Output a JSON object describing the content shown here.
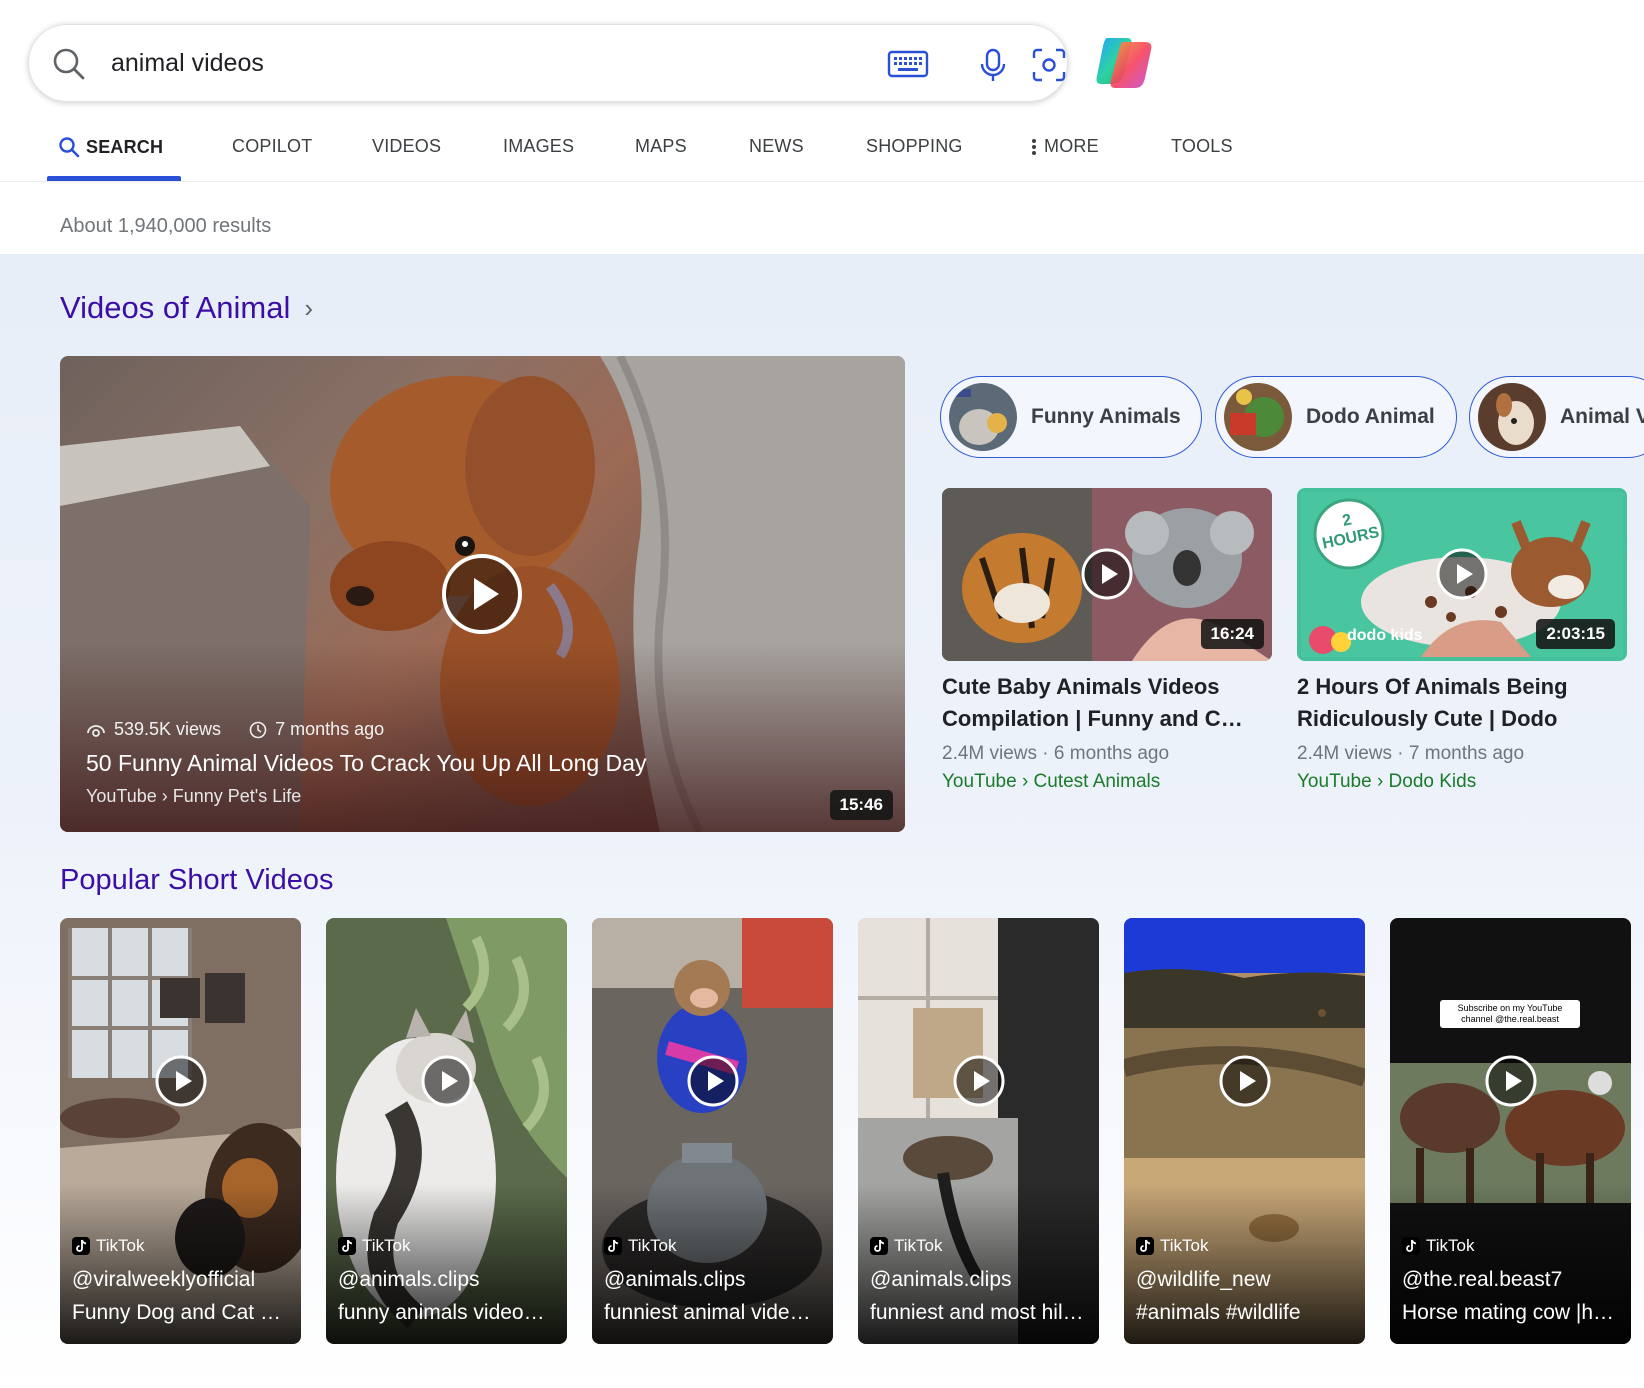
{
  "search": {
    "query": "animal videos"
  },
  "tabs": [
    {
      "label": "SEARCH"
    },
    {
      "label": "COPILOT"
    },
    {
      "label": "VIDEOS"
    },
    {
      "label": "IMAGES"
    },
    {
      "label": "MAPS"
    },
    {
      "label": "NEWS"
    },
    {
      "label": "SHOPPING"
    },
    {
      "label": "MORE"
    },
    {
      "label": "TOOLS"
    }
  ],
  "results_count": "About 1,940,000 results",
  "videos_section": {
    "title": "Videos of Animal",
    "hero": {
      "views": "539.5K views",
      "age": "7 months ago",
      "title": "50 Funny Animal Videos To Crack You Up All Long Day",
      "source": "YouTube › Funny Pet's Life",
      "duration": "15:46"
    },
    "chips": [
      {
        "label": "Funny Animals"
      },
      {
        "label": "Dodo Animal"
      },
      {
        "label": "Animal V"
      }
    ],
    "cards": [
      {
        "title_line1": "Cute Baby Animals Videos",
        "title_line2": "Compilation | Funny and C…",
        "meta": "2.4M views · 6 months ago",
        "source": "YouTube › Cutest Animals",
        "duration": "16:24"
      },
      {
        "title_line1": "2 Hours Of Animals Being",
        "title_line2": "Ridiculously Cute | Dodo",
        "meta": "2.4M views · 7 months ago",
        "source": "YouTube › Dodo Kids",
        "duration": "2:03:15",
        "badge": "2 HOURS",
        "logo_text": "dodo kids"
      }
    ]
  },
  "shorts_section": {
    "title": "Popular Short Videos",
    "items": [
      {
        "app": "TikTok",
        "author": "@viralweeklyofficial",
        "title": "Funny Dog and Cat …"
      },
      {
        "app": "TikTok",
        "author": "@animals.clips",
        "title": "funny animals video…"
      },
      {
        "app": "TikTok",
        "author": "@animals.clips",
        "title": "funniest animal vide…"
      },
      {
        "app": "TikTok",
        "author": "@animals.clips",
        "title": "funniest and most hil…"
      },
      {
        "app": "TikTok",
        "author": "@wildlife_new",
        "title": "#animals #wildlife"
      },
      {
        "app": "TikTok",
        "author": "@the.real.beast7",
        "title": "Horse mating cow |h…",
        "overlay_text": "Subscribe on my YouTube channel @the.real.beast"
      }
    ]
  },
  "colors": {
    "accent": "#2b50d8",
    "link": "#3b0fa6",
    "source_green": "#1a7b2a"
  }
}
